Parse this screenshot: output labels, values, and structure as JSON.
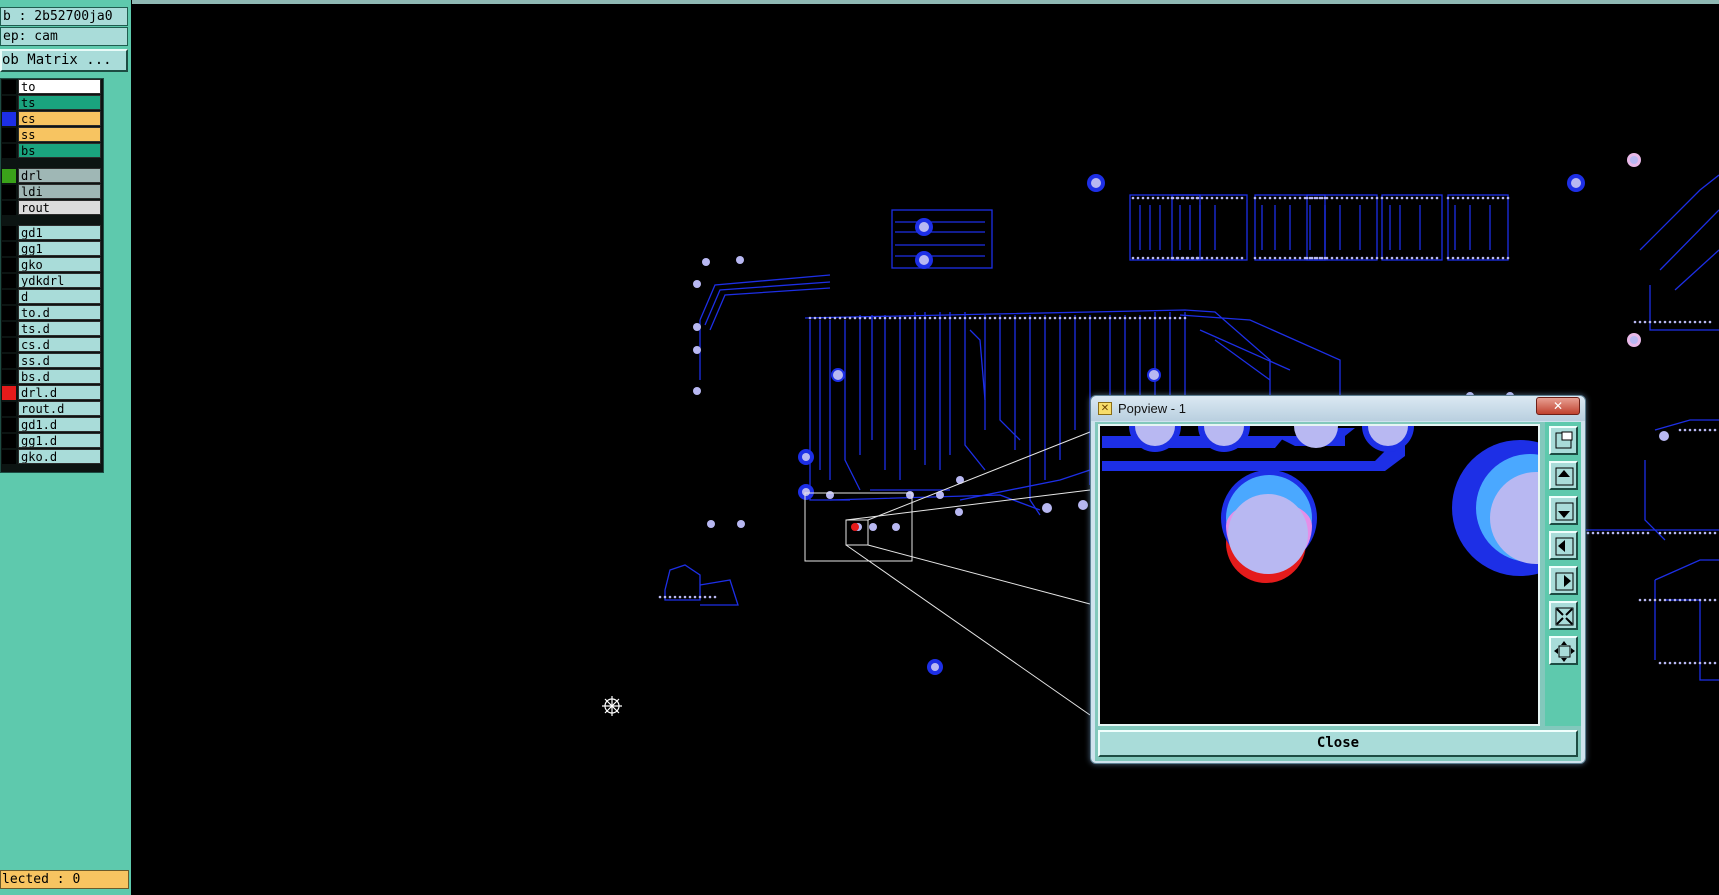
{
  "sidebar": {
    "job_label": "b : 2b52700ja0",
    "step_label": "ep: cam",
    "matrix_button": "ob Matrix ...",
    "selected_label": "lected : 0"
  },
  "layers": [
    {
      "name": "to",
      "bg": "#ffffff",
      "swatch": "#000000"
    },
    {
      "name": "ts",
      "bg": "#1aa37e",
      "swatch": "#000000"
    },
    {
      "name": "cs",
      "bg": "#f7c461",
      "swatch": "#1d2fe6"
    },
    {
      "name": "ss",
      "bg": "#f7c461",
      "swatch": "#000000"
    },
    {
      "name": "bs",
      "bg": "#1aa37e",
      "swatch": "#000000"
    },
    {
      "name": "drl",
      "bg": "#9fb7b5",
      "swatch": "#3aa21a"
    },
    {
      "name": "ldi",
      "bg": "#9fb7b5",
      "swatch": "#000000"
    },
    {
      "name": "rout",
      "bg": "#dcdcdc",
      "swatch": "#000000"
    },
    {
      "name": "gd1",
      "bg": "#a9dcd9",
      "swatch": "#000000"
    },
    {
      "name": "gg1",
      "bg": "#a9dcd9",
      "swatch": "#000000"
    },
    {
      "name": "gko",
      "bg": "#a9dcd9",
      "swatch": "#000000"
    },
    {
      "name": "ydkdrl",
      "bg": "#a9dcd9",
      "swatch": "#000000"
    },
    {
      "name": "d",
      "bg": "#a9dcd9",
      "swatch": "#000000"
    },
    {
      "name": "to.d",
      "bg": "#a9dcd9",
      "swatch": "#000000"
    },
    {
      "name": "ts.d",
      "bg": "#a9dcd9",
      "swatch": "#000000"
    },
    {
      "name": "cs.d",
      "bg": "#a9dcd9",
      "swatch": "#000000"
    },
    {
      "name": "ss.d",
      "bg": "#a9dcd9",
      "swatch": "#000000"
    },
    {
      "name": "bs.d",
      "bg": "#a9dcd9",
      "swatch": "#000000"
    },
    {
      "name": "drl.d",
      "bg": "#a9dcd9",
      "swatch": "#e41b1b"
    },
    {
      "name": "rout.d",
      "bg": "#a9dcd9",
      "swatch": "#000000"
    },
    {
      "name": "gd1.d",
      "bg": "#a9dcd9",
      "swatch": "#000000"
    },
    {
      "name": "gg1.d",
      "bg": "#a9dcd9",
      "swatch": "#000000"
    },
    {
      "name": "gko.d",
      "bg": "#a9dcd9",
      "swatch": "#000000"
    }
  ],
  "popview": {
    "title": "Popview - 1",
    "close_label": "Close",
    "close_x": "✕",
    "tools": [
      "zoom-window-icon",
      "pan-up-icon",
      "pan-down-icon",
      "pan-left-icon",
      "pan-right-icon",
      "zoom-out-icon",
      "zoom-fit-icon"
    ]
  },
  "colors": {
    "trace": "#1d2fe6",
    "pad_fill": "#b8b8f2",
    "drill": "#e41b1b",
    "accent_green": "#5ec9ad"
  }
}
